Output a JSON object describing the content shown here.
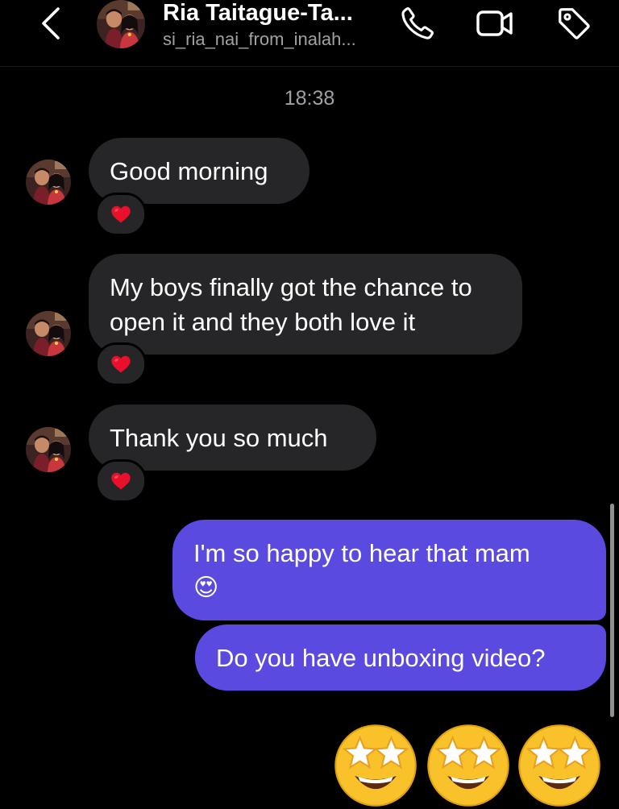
{
  "header": {
    "title": "Ria Taitague-Ta...",
    "username": "si_ria_nai_from_inalah...",
    "icons": [
      "chevron-left-icon",
      "phone-icon",
      "video-camera-icon",
      "tag-icon"
    ]
  },
  "conversation": {
    "timestamp": "18:38",
    "incoming": [
      {
        "text": "Good morning",
        "reaction": "❤️"
      },
      {
        "text": "My boys finally got the chance to open it and they both love it",
        "reaction": "❤️"
      },
      {
        "text": "Thank you so much",
        "reaction": "❤️"
      }
    ],
    "outgoing": [
      {
        "text": "I'm so happy to hear that mam",
        "emoji": "😍"
      },
      {
        "text": "Do you have unboxing video?"
      }
    ],
    "stickers": [
      "🤩",
      "🤩",
      "🤩"
    ]
  },
  "colors": {
    "background": "#000000",
    "incoming_bubble": "#262628",
    "outgoing_bubble": "#5a4ae0",
    "secondary_text": "#a0a0a5",
    "heart": "#e8102a"
  }
}
